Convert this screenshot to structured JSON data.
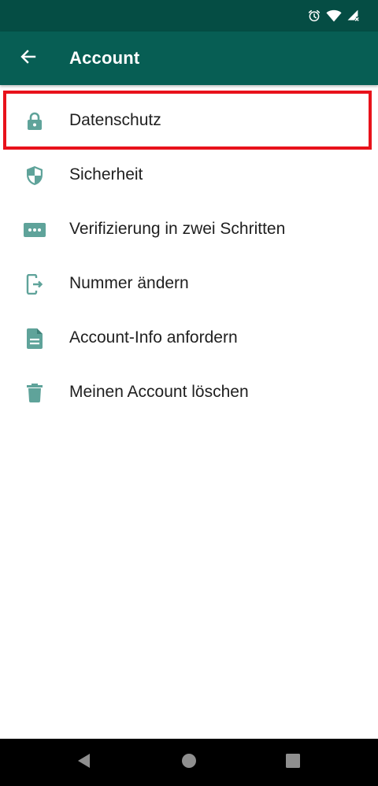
{
  "status_bar": {
    "icons": [
      "alarm-icon",
      "wifi-icon",
      "cellular-no-signal-icon"
    ]
  },
  "app_bar": {
    "title": "Account",
    "back_icon": "arrow-back-icon"
  },
  "menu": {
    "items": [
      {
        "label": "Datenschutz",
        "icon": "lock-icon",
        "highlighted": true
      },
      {
        "label": "Sicherheit",
        "icon": "shield-icon"
      },
      {
        "label": "Verifizierung in zwei Schritten",
        "icon": "password-dots-icon"
      },
      {
        "label": "Nummer ändern",
        "icon": "phone-change-icon"
      },
      {
        "label": "Account-Info anfordern",
        "icon": "document-icon"
      },
      {
        "label": "Meinen Account löschen",
        "icon": "trash-icon"
      }
    ]
  },
  "nav_bar": {
    "buttons": [
      "back-triangle-icon",
      "home-circle-icon",
      "recents-square-icon"
    ]
  },
  "colors": {
    "status_bar": "#054d44",
    "app_bar": "#075e54",
    "icon_tint": "#5fa39a",
    "highlight_border": "#e8121b",
    "nav_bar": "#000000"
  }
}
